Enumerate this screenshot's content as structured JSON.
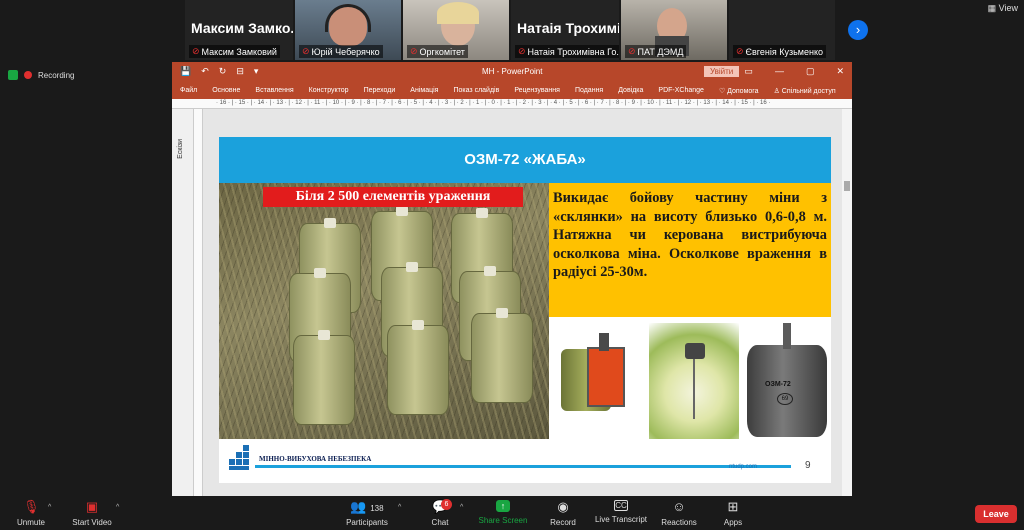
{
  "participants": [
    {
      "big": "Максим Замко...",
      "name": "Максим Замковий",
      "muted": true
    },
    {
      "big": "",
      "name": "Юрій Чеберячко",
      "muted": true,
      "video": true
    },
    {
      "big": "",
      "name": "Оргкомітет",
      "muted": true,
      "video": true
    },
    {
      "big": "Натаія Трохимі...",
      "name": "Натаія Трохимівна Го...",
      "muted": true
    },
    {
      "big": "",
      "name": "ПАТ ДЭМД",
      "muted": true,
      "video": true
    },
    {
      "big": "Євгенія Кузьменко",
      "name": "Євгенія Кузьменко",
      "muted": true
    }
  ],
  "top": {
    "next": "›",
    "view": "View",
    "recording": "Recording"
  },
  "ppt": {
    "title": "МН  -  PowerPoint",
    "signin": "Увійти",
    "qa": [
      "💾",
      "↶",
      "↻",
      "⊟",
      "▾"
    ],
    "window": [
      "▭",
      "—",
      "▢",
      "✕"
    ],
    "menu": [
      "Файл",
      "Основне",
      "Вставлення",
      "Конструктор",
      "Переходи",
      "Анімація",
      "Показ слайдів",
      "Рецензування",
      "Подання",
      "Довідка",
      "PDF-XChange",
      "♡ Допомога",
      "♙ Спільний доступ"
    ],
    "sidepanel": "Ескізи",
    "ruler": "· 16 · | · 15 · | · 14 · | · 13 · | · 12 · | · 11 · | · 10 · | · 9 · | · 8 · | · 7 · | · 6 · | · 5 · | · 4 · | · 3 · | · 2 · | · 1 · | · 0 · | · 1 · | · 2 · | · 3 · | · 4 · | · 5 · | · 6 · | · 7 · | · 8 · | · 9 · | · 10 · | · 11 · | · 12 · | · 13 · | · 14 · | · 15 · | · 16 ·"
  },
  "slide": {
    "heading": "ОЗМ-72 «ЖАБА»",
    "red_label": "Біля 2 500 елементів ураження",
    "description": "Викидає бойову частину міни з «склянки» на висоту близько 0,6-0,8 м. Натяжна чи керована вистрибуюча осколкова міна. Осколкове враження в радіусі 25-30м.",
    "mine_marking": "ОЗМ-72",
    "mine_marking2": "69",
    "footer_text": "МІННО-ВИБУХОВА НЕБЕЗПЕКА",
    "footer_url": "ntudp.com",
    "page_number": "9"
  },
  "toolbar": {
    "unmute": "Unmute",
    "start_video": "Start Video",
    "participants": "Participants",
    "participants_count": "138",
    "chat": "Chat",
    "chat_badge": "6",
    "share": "Share Screen",
    "record": "Record",
    "transcript": "Live Transcript",
    "reactions": "Reactions",
    "apps": "Apps",
    "leave": "Leave"
  }
}
